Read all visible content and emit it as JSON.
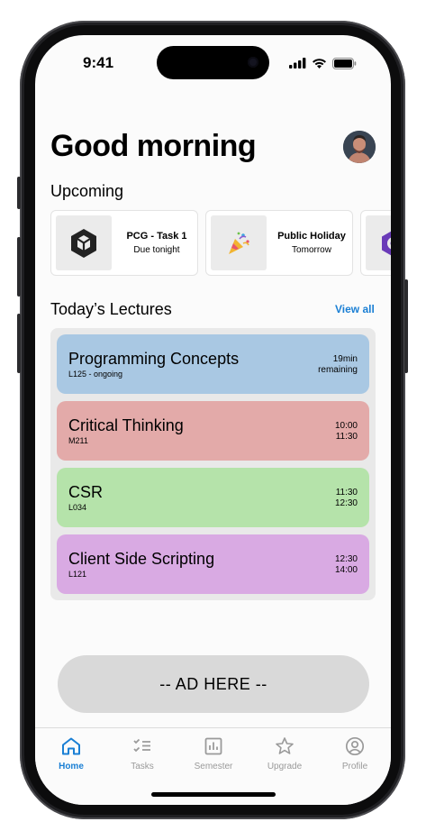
{
  "status_bar": {
    "time": "9:41",
    "icons": [
      "signal-icon",
      "wifi-icon",
      "battery-icon"
    ]
  },
  "header": {
    "greeting": "Good morning",
    "avatar": "avatar"
  },
  "upcoming": {
    "heading": "Upcoming",
    "items": [
      {
        "title": "PCG - Task 1",
        "subtitle": "Due tonight",
        "icon": "unity-logo-icon"
      },
      {
        "title": "Public Holiday",
        "subtitle": "Tomorrow",
        "icon": "party-popper-icon"
      },
      {
        "title": "",
        "subtitle": "",
        "icon": "purple-hexagon-icon"
      }
    ]
  },
  "lectures": {
    "heading": "Today’s Lectures",
    "view_all": "View all",
    "items": [
      {
        "name": "Programming Concepts",
        "room": "L125 - ongoing",
        "time1": "19min",
        "time2": "remaining",
        "color": "#a9c8e3"
      },
      {
        "name": "Critical Thinking",
        "room": "M211",
        "time1": "10:00",
        "time2": "11:30",
        "color": "#e3aaa9"
      },
      {
        "name": "CSR",
        "room": "L034",
        "time1": "11:30",
        "time2": "12:30",
        "color": "#b5e3aa"
      },
      {
        "name": "Client Side Scripting",
        "room": "L121",
        "time1": "12:30",
        "time2": "14:00",
        "color": "#d9aae3"
      }
    ]
  },
  "ad": {
    "label": "-- AD HERE --"
  },
  "tabbar": {
    "active_color": "#1a7fd4",
    "items": [
      {
        "label": "Home",
        "icon": "home-icon",
        "active": true
      },
      {
        "label": "Tasks",
        "icon": "checklist-icon",
        "active": false
      },
      {
        "label": "Semester",
        "icon": "bar-chart-icon",
        "active": false
      },
      {
        "label": "Upgrade",
        "icon": "star-icon",
        "active": false
      },
      {
        "label": "Profile",
        "icon": "profile-icon",
        "active": false
      }
    ]
  }
}
